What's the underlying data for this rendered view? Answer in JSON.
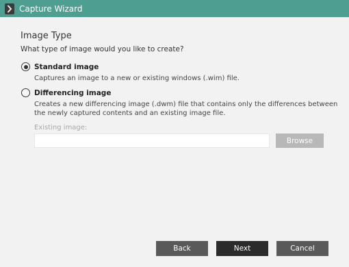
{
  "window": {
    "title": "Capture Wizard",
    "app_icon": "chevron-right-icon"
  },
  "page": {
    "heading": "Image Type",
    "subheading": "What type of image would you like to create?"
  },
  "options": [
    {
      "label": "Standard image",
      "description_lines": [
        "Captures an image to a new or existing windows (.wim) file."
      ],
      "selected": true
    },
    {
      "label": "Differencing image",
      "description_lines": [
        "Creates a new differencing image (.dwm) file that contains only the differences between",
        "the newly captured contents and an existing image file."
      ],
      "selected": false
    }
  ],
  "existing_image": {
    "label": "Existing image:",
    "value": "",
    "browse_label": "Browse"
  },
  "footer": {
    "back_label": "Back",
    "next_label": "Next",
    "cancel_label": "Cancel"
  },
  "colors": {
    "titlebar": "#4f9e92",
    "background": "#f2f2f2",
    "button": "#595959",
    "primary_button": "#2b2b2b",
    "disabled_button": "#b8b8b8"
  }
}
